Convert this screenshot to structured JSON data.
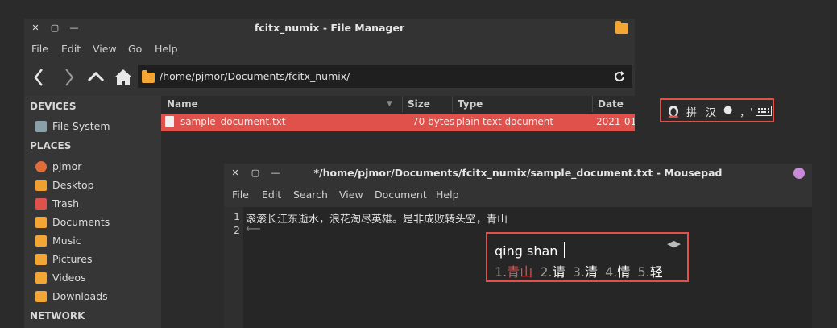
{
  "file_manager": {
    "title": "fcitx_numix - File Manager",
    "menu": [
      "File",
      "Edit",
      "View",
      "Go",
      "Help"
    ],
    "path": "/home/pjmor/Documents/fcitx_numix/",
    "sidebar": {
      "devices_header": "DEVICES",
      "devices": [
        {
          "label": "File System",
          "icon": "drive-icon"
        }
      ],
      "places_header": "PLACES",
      "places": [
        {
          "label": "pjmor",
          "icon": "home-icon"
        },
        {
          "label": "Desktop",
          "icon": "desktop-icon"
        },
        {
          "label": "Trash",
          "icon": "trash-icon"
        },
        {
          "label": "Documents",
          "icon": "documents-icon"
        },
        {
          "label": "Music",
          "icon": "music-icon"
        },
        {
          "label": "Pictures",
          "icon": "pictures-icon"
        },
        {
          "label": "Videos",
          "icon": "videos-icon"
        },
        {
          "label": "Downloads",
          "icon": "downloads-icon"
        }
      ],
      "network_header": "NETWORK"
    },
    "columns": [
      "Name",
      "Size",
      "Type",
      "Date Mo"
    ],
    "files": [
      {
        "name": "sample_document.txt",
        "size": "70 bytes",
        "type": "plain text document",
        "date": "2021-01"
      }
    ],
    "colors": {
      "selection": "#e0514c",
      "folder": "#f3a633"
    }
  },
  "tray": {
    "items": [
      "拼",
      "汉",
      "●",
      "，'"
    ],
    "icons": [
      "penguin-icon",
      "keyboard-icon"
    ]
  },
  "mousepad": {
    "title": "*/home/pjmor/Documents/fcitx_numix/sample_document.txt - Mousepad",
    "menu": [
      "File",
      "Edit",
      "Search",
      "View",
      "Document",
      "Help"
    ],
    "lines": [
      {
        "num": "1",
        "text": "滚滚长江东逝水，浪花淘尽英雄。是非成败转头空，青山"
      },
      {
        "num": "2",
        "text": "⟵"
      }
    ]
  },
  "ime": {
    "preedit": "qing shan",
    "candidates": [
      {
        "index": "1.",
        "text": "青山"
      },
      {
        "index": "2.",
        "text": "请"
      },
      {
        "index": "3.",
        "text": "清"
      },
      {
        "index": "4.",
        "text": "情"
      },
      {
        "index": "5.",
        "text": "轻"
      }
    ]
  }
}
